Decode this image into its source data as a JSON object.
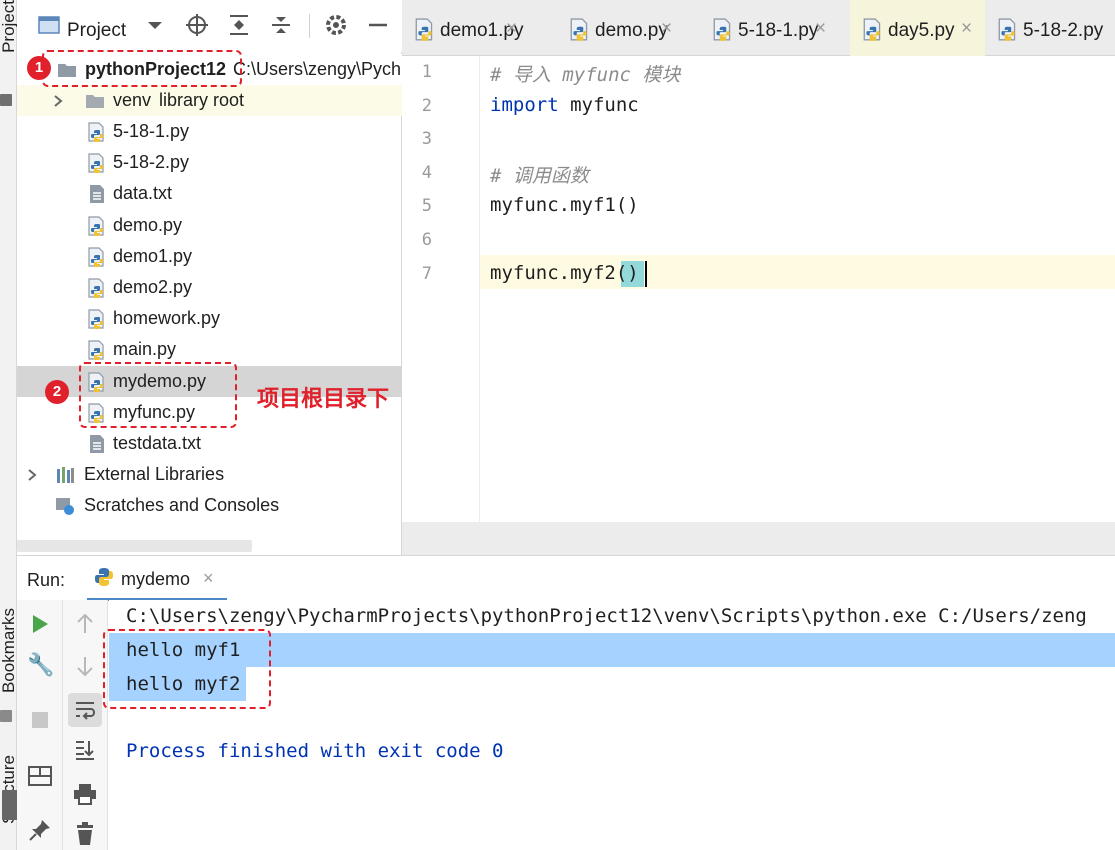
{
  "side_strip": {
    "project": "Project",
    "bookmarks": "Bookmarks",
    "structure": "Structure"
  },
  "project_panel": {
    "title": "Project",
    "root": {
      "name": "pythonProject12",
      "path": "C:\\Users\\zengy\\Pych"
    },
    "tree": [
      {
        "name": "venv",
        "hint": "library root",
        "type": "folder"
      },
      {
        "name": "5-18-1.py",
        "type": "py"
      },
      {
        "name": "5-18-2.py",
        "type": "py"
      },
      {
        "name": "data.txt",
        "type": "txt"
      },
      {
        "name": "demo.py",
        "type": "py"
      },
      {
        "name": "demo1.py",
        "type": "py"
      },
      {
        "name": "demo2.py",
        "type": "py"
      },
      {
        "name": "homework.py",
        "type": "py"
      },
      {
        "name": "main.py",
        "type": "py"
      },
      {
        "name": "mydemo.py",
        "type": "py",
        "selected": true
      },
      {
        "name": "myfunc.py",
        "type": "py"
      },
      {
        "name": "testdata.txt",
        "type": "txt"
      }
    ],
    "external_libraries": "External Libraries",
    "scratches": "Scratches and Consoles"
  },
  "tabs": [
    {
      "label": "demo1.py"
    },
    {
      "label": "demo.py"
    },
    {
      "label": "5-18-1.py"
    },
    {
      "label": "day5.py",
      "active": true
    },
    {
      "label": "5-18-2.py"
    }
  ],
  "editor": {
    "lines": [
      {
        "n": "1",
        "kind": "comment",
        "text": "# 导入 myfunc 模块"
      },
      {
        "n": "2",
        "kind": "import",
        "kw": "import",
        "rest": " myfunc"
      },
      {
        "n": "3",
        "kind": "blank",
        "text": ""
      },
      {
        "n": "4",
        "kind": "comment",
        "text": "# 调用函数"
      },
      {
        "n": "5",
        "kind": "code",
        "text": "myfunc.myf1()"
      },
      {
        "n": "6",
        "kind": "blank",
        "text": ""
      },
      {
        "n": "7",
        "kind": "code",
        "text": "myfunc.myf2()"
      }
    ]
  },
  "run": {
    "label": "Run:",
    "tab": "mydemo",
    "console": [
      "C:\\Users\\zengy\\PycharmProjects\\pythonProject12\\venv\\Scripts\\python.exe C:/Users/zeng",
      "hello myf1",
      "hello myf2",
      "",
      "Process finished with exit code 0"
    ]
  },
  "annotations": {
    "badge1": "1",
    "badge2": "2",
    "note": "项目根目录下"
  },
  "colors": {
    "accent_red": "#e0202a",
    "selection": "#a6d2ff",
    "keyword": "#0033b3"
  }
}
